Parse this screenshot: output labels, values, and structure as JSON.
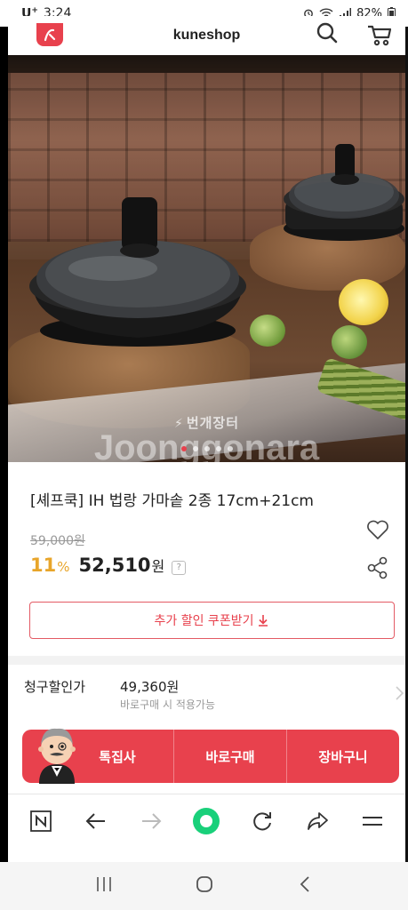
{
  "status_bar": {
    "carrier": "U",
    "carrier_sup": "+",
    "time": "3:24",
    "battery": "82%"
  },
  "header": {
    "title": "kuneshop"
  },
  "product_image": {
    "watermark_brand": "번개장터",
    "watermark_text": "Joonggonara",
    "dots_total": 5,
    "dots_active": 1
  },
  "product": {
    "title": "[셰프쿡] IH 법랑 가마솥 2종 17cm+21cm",
    "original_price": "59,000원",
    "discount_value": "11",
    "discount_unit": "%",
    "sale_price": "52,510",
    "currency": "원",
    "help_glyph": "?"
  },
  "coupon": {
    "label": "추가 할인 쿠폰받기"
  },
  "billing": {
    "label": "청구할인가",
    "price": "49,360원",
    "note": "바로구매 시 적용가능"
  },
  "actions": {
    "special": "톡집사",
    "buy_now": "바로구매",
    "cart": "장바구니"
  },
  "colors": {
    "accent": "#e8414d",
    "discount": "#e8a52a"
  },
  "icons": {
    "browser_toolbar": [
      "naver-n-icon",
      "back-icon",
      "forward-icon",
      "home-circle-icon",
      "refresh-icon",
      "share-arrow-icon",
      "menu-icon"
    ],
    "system_nav": [
      "recent-apps-icon",
      "home-icon",
      "back-icon"
    ]
  }
}
